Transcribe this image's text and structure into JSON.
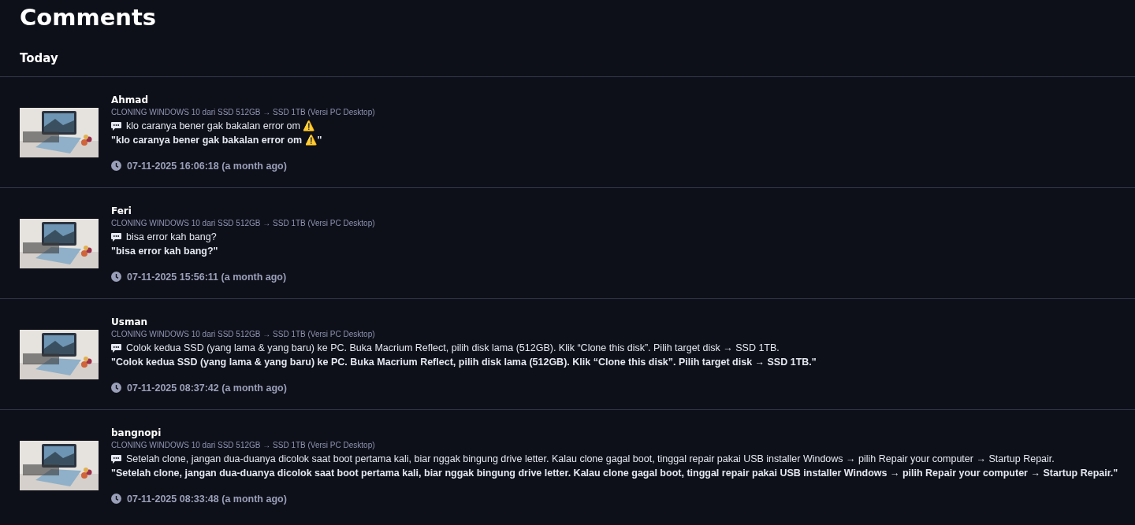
{
  "title": "Comments",
  "groups": [
    {
      "label": "Today",
      "comments": [
        {
          "author": "Ahmad",
          "post": "CLONING WINDOWS 10 dari SSD 512GB → SSD 1TB (Versi PC Desktop)",
          "text": "klo caranya bener gak bakalan error om ⚠️",
          "quote": "\"klo caranya bener gak bakalan error om ⚠️\"",
          "time": "07-11-2025 16:06:18 (a month ago)"
        },
        {
          "author": "Feri",
          "post": "CLONING WINDOWS 10 dari SSD 512GB → SSD 1TB (Versi PC Desktop)",
          "text": "bisa error kah bang?",
          "quote": "\"bisa error kah bang?\"",
          "time": "07-11-2025 15:56:11 (a month ago)"
        },
        {
          "author": "Usman",
          "post": "CLONING WINDOWS 10 dari SSD 512GB → SSD 1TB (Versi PC Desktop)",
          "text": "Colok kedua SSD (yang lama & yang baru) ke PC. Buka Macrium Reflect, pilih disk lama (512GB). Klik “Clone this disk”. Pilih target disk → SSD 1TB.",
          "quote": "\"Colok kedua SSD (yang lama & yang baru) ke PC. Buka Macrium Reflect, pilih disk lama (512GB). Klik “Clone this disk”. Pilih target disk → SSD 1TB.\"",
          "time": "07-11-2025 08:37:42 (a month ago)"
        },
        {
          "author": "bangnopi",
          "post": "CLONING WINDOWS 10 dari SSD 512GB → SSD 1TB (Versi PC Desktop)",
          "text": "Setelah clone, jangan dua-duanya dicolok saat boot pertama kali, biar nggak bingung drive letter. Kalau clone gagal boot, tinggal repair pakai USB installer Windows → pilih Repair your computer → Startup Repair.",
          "quote": "\"Setelah clone, jangan dua-duanya dicolok saat boot pertama kali, biar nggak bingung drive letter. Kalau clone gagal boot, tinggal repair pakai USB installer Windows → pilih Repair your computer → Startup Repair.\"",
          "time": "07-11-2025 08:33:48 (a month ago)"
        }
      ]
    }
  ]
}
